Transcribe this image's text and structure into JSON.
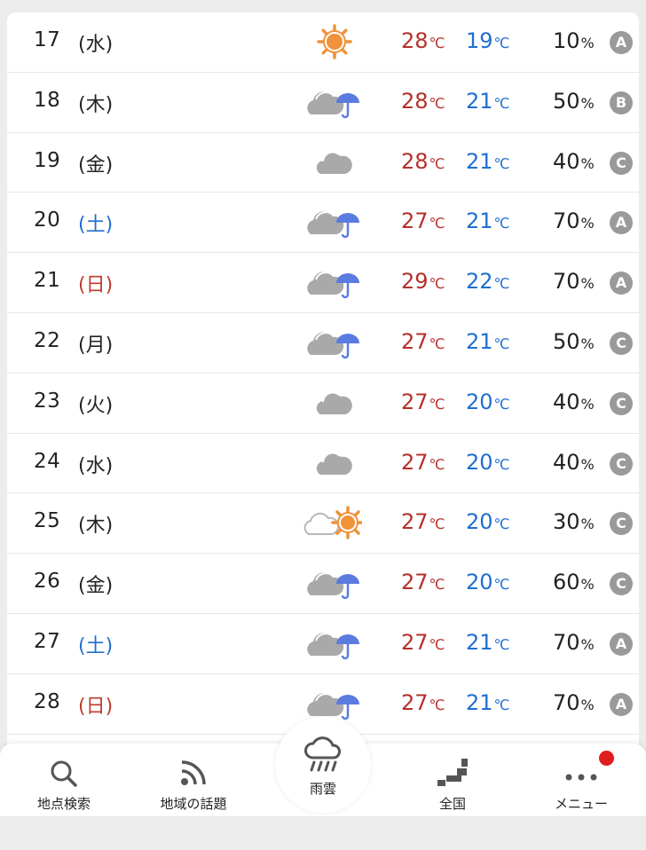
{
  "forecast": [
    {
      "date": "17",
      "dow": "(水)",
      "dow_type": "weekday",
      "weather": "sunny",
      "hi": "28",
      "lo": "19",
      "pop": "10",
      "reliability": "A"
    },
    {
      "date": "18",
      "dow": "(木)",
      "dow_type": "weekday",
      "weather": "cloudy-rain",
      "hi": "28",
      "lo": "21",
      "pop": "50",
      "reliability": "B"
    },
    {
      "date": "19",
      "dow": "(金)",
      "dow_type": "weekday",
      "weather": "cloudy",
      "hi": "28",
      "lo": "21",
      "pop": "40",
      "reliability": "C"
    },
    {
      "date": "20",
      "dow": "(土)",
      "dow_type": "sat",
      "weather": "cloudy-rain",
      "hi": "27",
      "lo": "21",
      "pop": "70",
      "reliability": "A"
    },
    {
      "date": "21",
      "dow": "(日)",
      "dow_type": "sun",
      "weather": "cloudy-rain",
      "hi": "29",
      "lo": "22",
      "pop": "70",
      "reliability": "A"
    },
    {
      "date": "22",
      "dow": "(月)",
      "dow_type": "weekday",
      "weather": "cloudy-rain",
      "hi": "27",
      "lo": "21",
      "pop": "50",
      "reliability": "C"
    },
    {
      "date": "23",
      "dow": "(火)",
      "dow_type": "weekday",
      "weather": "cloudy",
      "hi": "27",
      "lo": "20",
      "pop": "40",
      "reliability": "C"
    },
    {
      "date": "24",
      "dow": "(水)",
      "dow_type": "weekday",
      "weather": "cloudy",
      "hi": "27",
      "lo": "20",
      "pop": "40",
      "reliability": "C"
    },
    {
      "date": "25",
      "dow": "(木)",
      "dow_type": "weekday",
      "weather": "cloudy-sunny",
      "hi": "27",
      "lo": "20",
      "pop": "30",
      "reliability": "C"
    },
    {
      "date": "26",
      "dow": "(金)",
      "dow_type": "weekday",
      "weather": "cloudy-rain",
      "hi": "27",
      "lo": "20",
      "pop": "60",
      "reliability": "C"
    },
    {
      "date": "27",
      "dow": "(土)",
      "dow_type": "sat",
      "weather": "cloudy-rain",
      "hi": "27",
      "lo": "21",
      "pop": "70",
      "reliability": "A"
    },
    {
      "date": "28",
      "dow": "(日)",
      "dow_type": "sun",
      "weather": "cloudy-rain",
      "hi": "27",
      "lo": "21",
      "pop": "70",
      "reliability": "A"
    }
  ],
  "units": {
    "temp": "℃",
    "pop": "%"
  },
  "nav": {
    "search": "地点検索",
    "topics": "地域の話題",
    "rain": "雨雲",
    "national": "全国",
    "menu": "メニュー"
  },
  "colors": {
    "high": "#b5302a",
    "low": "#1f6fd1",
    "saturday": "#1f6fd1",
    "sunday": "#c0392b",
    "sun": "#f0923a",
    "cloud": "#a9a9a9",
    "umbrella": "#5a7be0",
    "badge": "#e01e1e"
  }
}
